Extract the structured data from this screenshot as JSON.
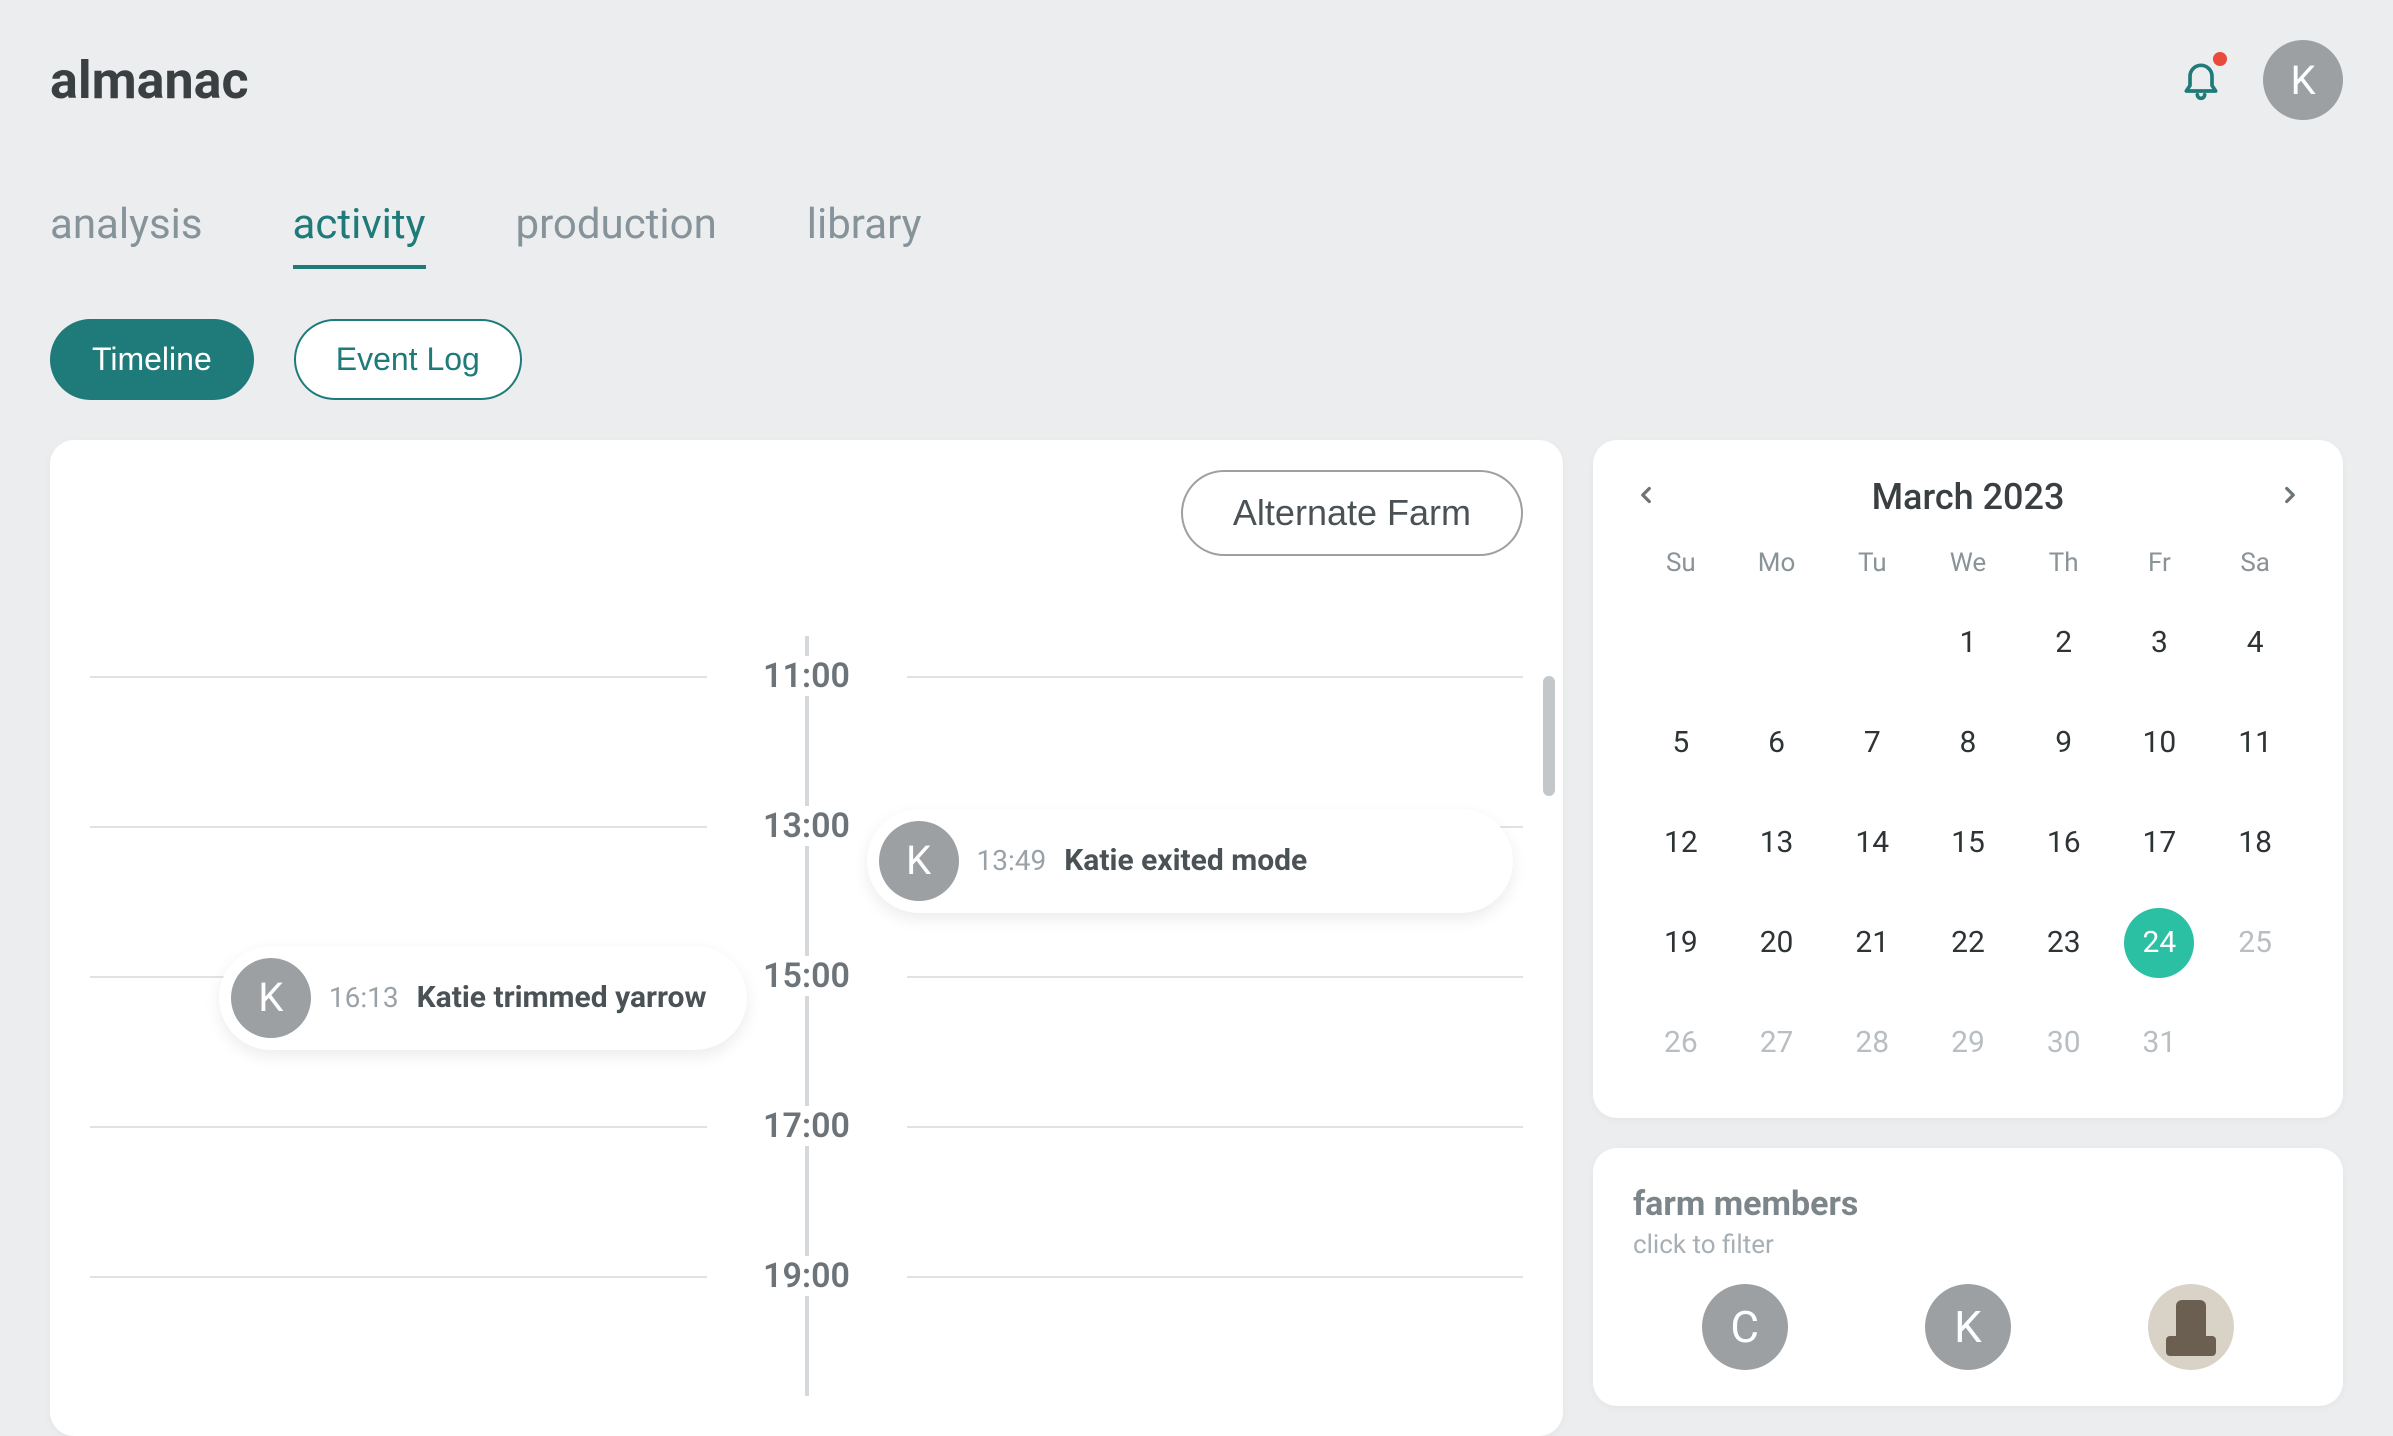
{
  "brand": "almanac",
  "header": {
    "avatar_initial": "K"
  },
  "tabs": [
    {
      "id": "analysis",
      "label": "analysis",
      "active": false
    },
    {
      "id": "activity",
      "label": "activity",
      "active": true
    },
    {
      "id": "production",
      "label": "production",
      "active": false
    },
    {
      "id": "library",
      "label": "library",
      "active": false
    }
  ],
  "subtabs": {
    "timeline": "Timeline",
    "eventlog": "Event Log"
  },
  "timeline": {
    "alternate_button": "Alternate Farm",
    "hours": [
      "11:00",
      "13:00",
      "15:00",
      "17:00",
      "19:00"
    ],
    "events": [
      {
        "side": "right",
        "avatar": "K",
        "time": "13:49",
        "text": "Katie exited mode",
        "offset_pct": 24
      },
      {
        "side": "left",
        "avatar": "K",
        "time": "16:13",
        "text": "Katie trimmed yarrow",
        "offset_pct": 43
      }
    ]
  },
  "calendar": {
    "title": "March 2023",
    "dow": [
      "Su",
      "Mo",
      "Tu",
      "We",
      "Th",
      "Fr",
      "Sa"
    ],
    "leading_blanks": 3,
    "days_in_month": 31,
    "selected_day": 24,
    "muted_after": 24
  },
  "members": {
    "title": "farm members",
    "subtitle": "click to filter",
    "list": [
      {
        "initial": "C",
        "type": "letter"
      },
      {
        "initial": "K",
        "type": "letter"
      },
      {
        "initial": "",
        "type": "image"
      }
    ]
  }
}
